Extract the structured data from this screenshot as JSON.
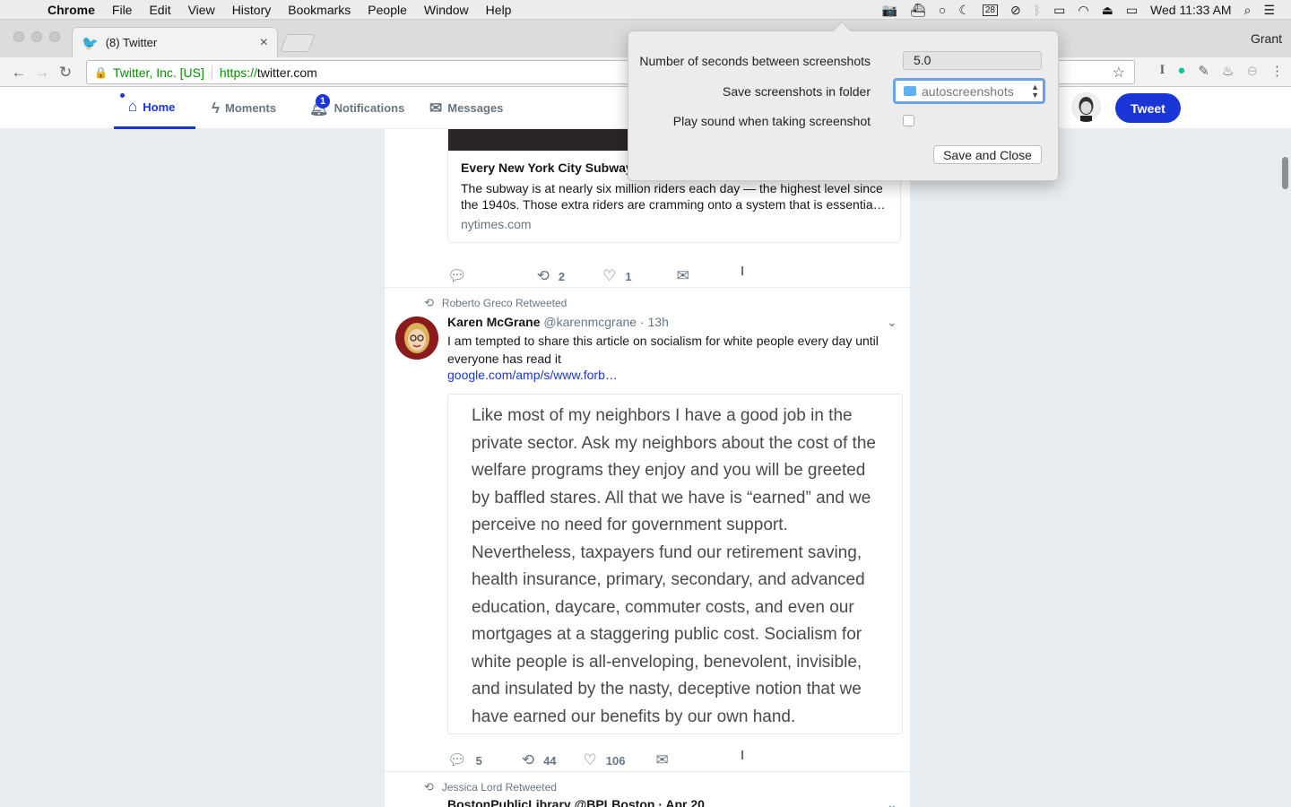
{
  "menubar": {
    "app": "Chrome",
    "items": [
      "File",
      "Edit",
      "View",
      "History",
      "Bookmarks",
      "People",
      "Window",
      "Help"
    ],
    "calendar_day": "28",
    "clock": "Wed 11:33 AM"
  },
  "chrome": {
    "tab_title": "(8) Twitter",
    "user": "Grant",
    "site_identity": "Twitter, Inc. [US]",
    "url_scheme": "https://",
    "url_host": "twitter.com"
  },
  "twitter_nav": {
    "home": "Home",
    "moments": "Moments",
    "notifications": "Notifications",
    "notification_count": "1",
    "messages": "Messages",
    "tweet_button": "Tweet"
  },
  "tweet1": {
    "card_title": "Every New York City Subway",
    "card_desc": "The subway is at nearly six million riders each day — the highest level since the 1940s. Those extra riders are cramming onto a system that is essentia…",
    "card_domain": "nytimes.com",
    "retweets": "2",
    "likes": "1"
  },
  "tweet2": {
    "retweeted_by": "Roberto Greco Retweeted",
    "name": "Karen McGrane",
    "handle": "@karenmcgrane",
    "time": "· 13h",
    "text": "I am tempted to share this article on socialism for white people every day until everyone has read it",
    "link": "google.com/amp/s/www.forb…",
    "quote": "Like most of my neighbors I have a good job in the private sector. Ask my neighbors about the cost of the welfare programs they enjoy and you will be greeted by baffled stares. All that we have is “earned” and we perceive no need for government support. Nevertheless, taxpayers fund our retirement saving, health insurance, primary, secondary, and advanced education, daycare, commuter costs, and even our mortgages at a staggering public cost. Socialism for white people is all-enveloping, benevolent, invisible, and insulated by the nasty, deceptive notion that we have earned our benefits by our own hand.",
    "replies": "5",
    "retweets": "44",
    "likes": "106"
  },
  "tweet3": {
    "retweeted_by": "Jessica Lord Retweeted",
    "header": "BostonPublicLibrary @BPLBoston · Apr 20"
  },
  "popover": {
    "seconds_label": "Number of seconds between screenshots",
    "seconds_value": "5.0",
    "folder_label": "Save screenshots in folder",
    "folder_value": "autoscreenshots",
    "sound_label": "Play sound when taking screenshot",
    "sound_checked": false,
    "save_button": "Save and Close"
  },
  "colors": {
    "twitter_blue": "#1b36d6",
    "chrome_secure_green": "#0a8f08",
    "focus_ring": "#6aa3ea"
  }
}
